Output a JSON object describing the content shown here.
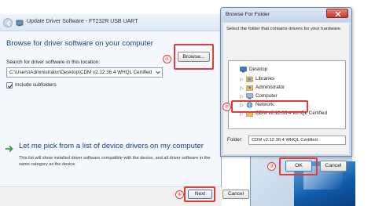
{
  "wizard": {
    "title": "Update Driver Software - FT232R USB UART",
    "heading": "Browse for driver software on your computer",
    "search_label": "Search for driver software in this location:",
    "path_value": "C:\\Users\\Administrator\\Desktop\\CDM v2.12.36.4 WHQL Certified",
    "browse_label": "Browse...",
    "include_subfolders_label": "Include subfolders",
    "include_subfolders_checked": true,
    "pick_heading": "Let me pick from a list of device drivers on my computer",
    "pick_description": "This list will show installed driver software compatible with the device, and all driver software in the same category as the device.",
    "next_label": "Next",
    "cancel_label": "Cancel"
  },
  "browse_dialog": {
    "title": "Browse For Folder",
    "instruction": "Select the folder that contains drivers for your hardware.",
    "tree": [
      {
        "label": "Desktop",
        "icon": "desktop-icon"
      },
      {
        "label": "Libraries",
        "icon": "libraries-icon"
      },
      {
        "label": "Administrator",
        "icon": "user-folder-icon"
      },
      {
        "label": "Computer",
        "icon": "computer-icon"
      },
      {
        "label": "Network",
        "icon": "network-icon"
      },
      {
        "label": "CDM v2.12.36.4 WHQL Certified",
        "icon": "folder-icon",
        "selected": true
      }
    ],
    "folder_label": "Folder:",
    "folder_value": "CDM v2.12.36.4 WHQL Certified",
    "ok_label": "OK",
    "cancel_label": "Cancel"
  },
  "step_markers": {
    "step1": "①",
    "step2": "②",
    "step3": "③",
    "step4": "④"
  },
  "colors": {
    "highlight": "#e23b3b",
    "heading": "#1f3f8f"
  }
}
